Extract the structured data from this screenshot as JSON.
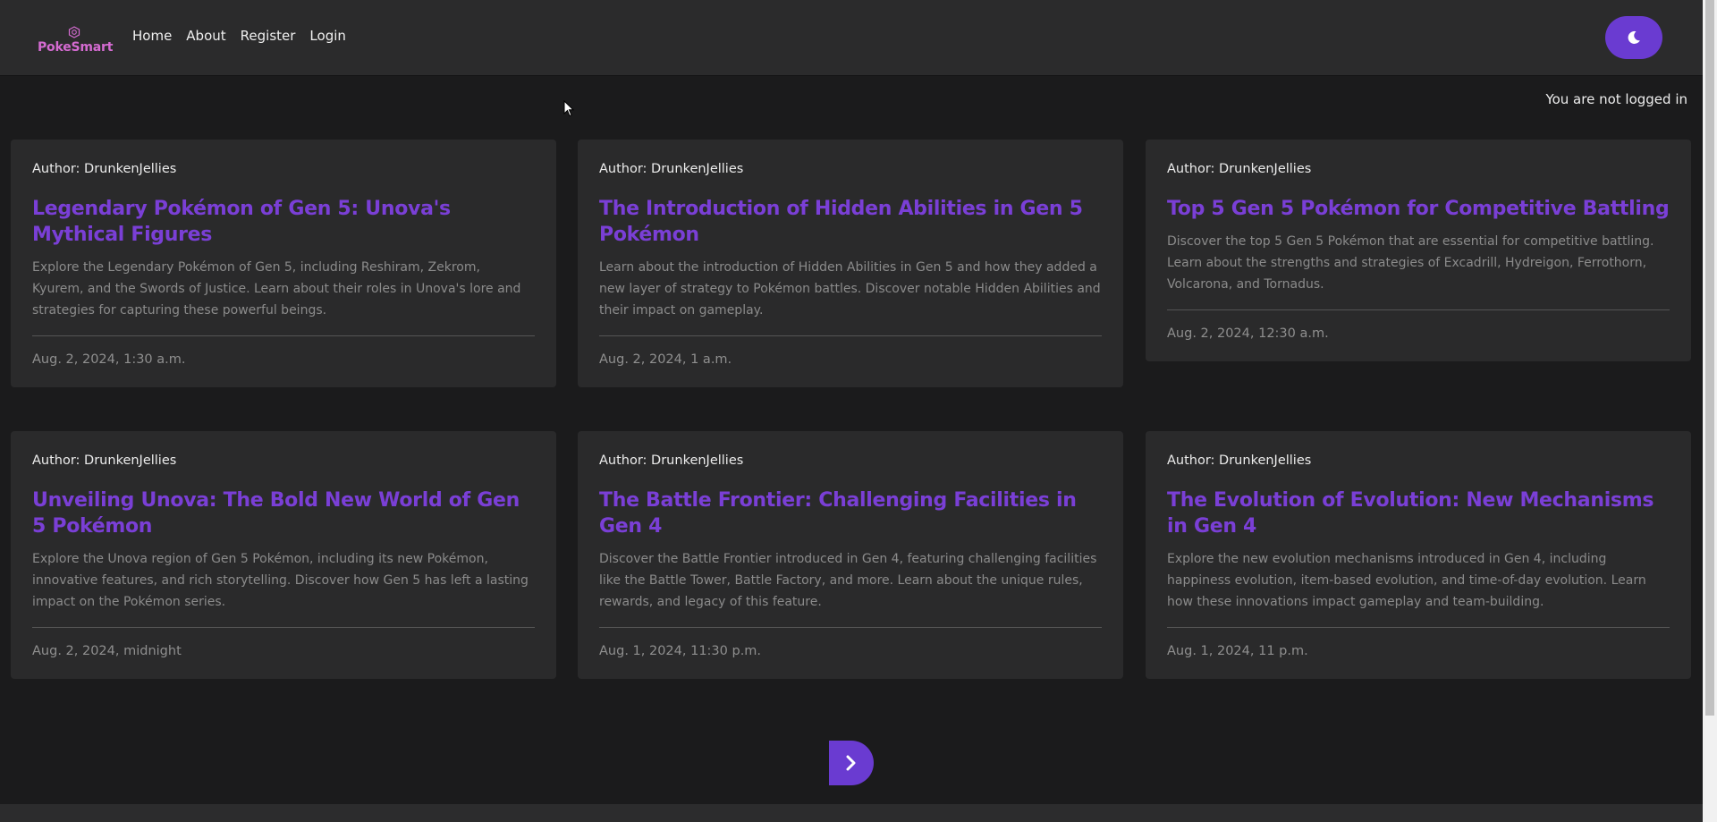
{
  "navbar": {
    "brand": "PokeSmart",
    "links": [
      "Home",
      "About",
      "Register",
      "Login"
    ],
    "theme_toggle_icon": "moon-icon"
  },
  "status": {
    "login_text": "You are not logged in"
  },
  "posts": [
    {
      "author": "Author: DrunkenJellies",
      "title": "Legendary Pokémon of Gen 5: Unova's Mythical Figures",
      "description": "Explore the Legendary Pokémon of Gen 5, including Reshiram, Zekrom, Kyurem, and the Swords of Justice. Learn about their roles in Unova's lore and strategies for capturing these powerful beings.",
      "date": "Aug. 2, 2024, 1:30 a.m."
    },
    {
      "author": "Author: DrunkenJellies",
      "title": "The Introduction of Hidden Abilities in Gen 5 Pokémon",
      "description": "Learn about the introduction of Hidden Abilities in Gen 5 and how they added a new layer of strategy to Pokémon battles. Discover notable Hidden Abilities and their impact on gameplay.",
      "date": "Aug. 2, 2024, 1 a.m."
    },
    {
      "author": "Author: DrunkenJellies",
      "title": "Top 5 Gen 5 Pokémon for Competitive Battling",
      "description": "Discover the top 5 Gen 5 Pokémon that are essential for competitive battling. Learn about the strengths and strategies of Excadrill, Hydreigon, Ferrothorn, Volcarona, and Tornadus.",
      "date": "Aug. 2, 2024, 12:30 a.m."
    },
    {
      "author": "Author: DrunkenJellies",
      "title": "Unveiling Unova: The Bold New World of Gen 5 Pokémon",
      "description": "Explore the Unova region of Gen 5 Pokémon, including its new Pokémon, innovative features, and rich storytelling. Discover how Gen 5 has left a lasting impact on the Pokémon series.",
      "date": "Aug. 2, 2024, midnight"
    },
    {
      "author": "Author: DrunkenJellies",
      "title": "The Battle Frontier: Challenging Facilities in Gen 4",
      "description": "Discover the Battle Frontier introduced in Gen 4, featuring challenging facilities like the Battle Tower, Battle Factory, and more. Learn about the unique rules, rewards, and legacy of this feature.",
      "date": "Aug. 1, 2024, 11:30 p.m."
    },
    {
      "author": "Author: DrunkenJellies",
      "title": "The Evolution of Evolution: New Mechanisms in Gen 4",
      "description": "Explore the new evolution mechanisms introduced in Gen 4, including happiness evolution, item-based evolution, and time-of-day evolution. Learn how these innovations impact gameplay and team-building.",
      "date": "Aug. 1, 2024, 11 p.m."
    }
  ],
  "pagination": {
    "next_icon": "chevron-right-icon"
  },
  "colors": {
    "accent": "#6a3bd1",
    "title": "#7a3fd6",
    "brand": "#d46bd1",
    "background": "#1b1b1c",
    "card": "#2a2a2b"
  }
}
